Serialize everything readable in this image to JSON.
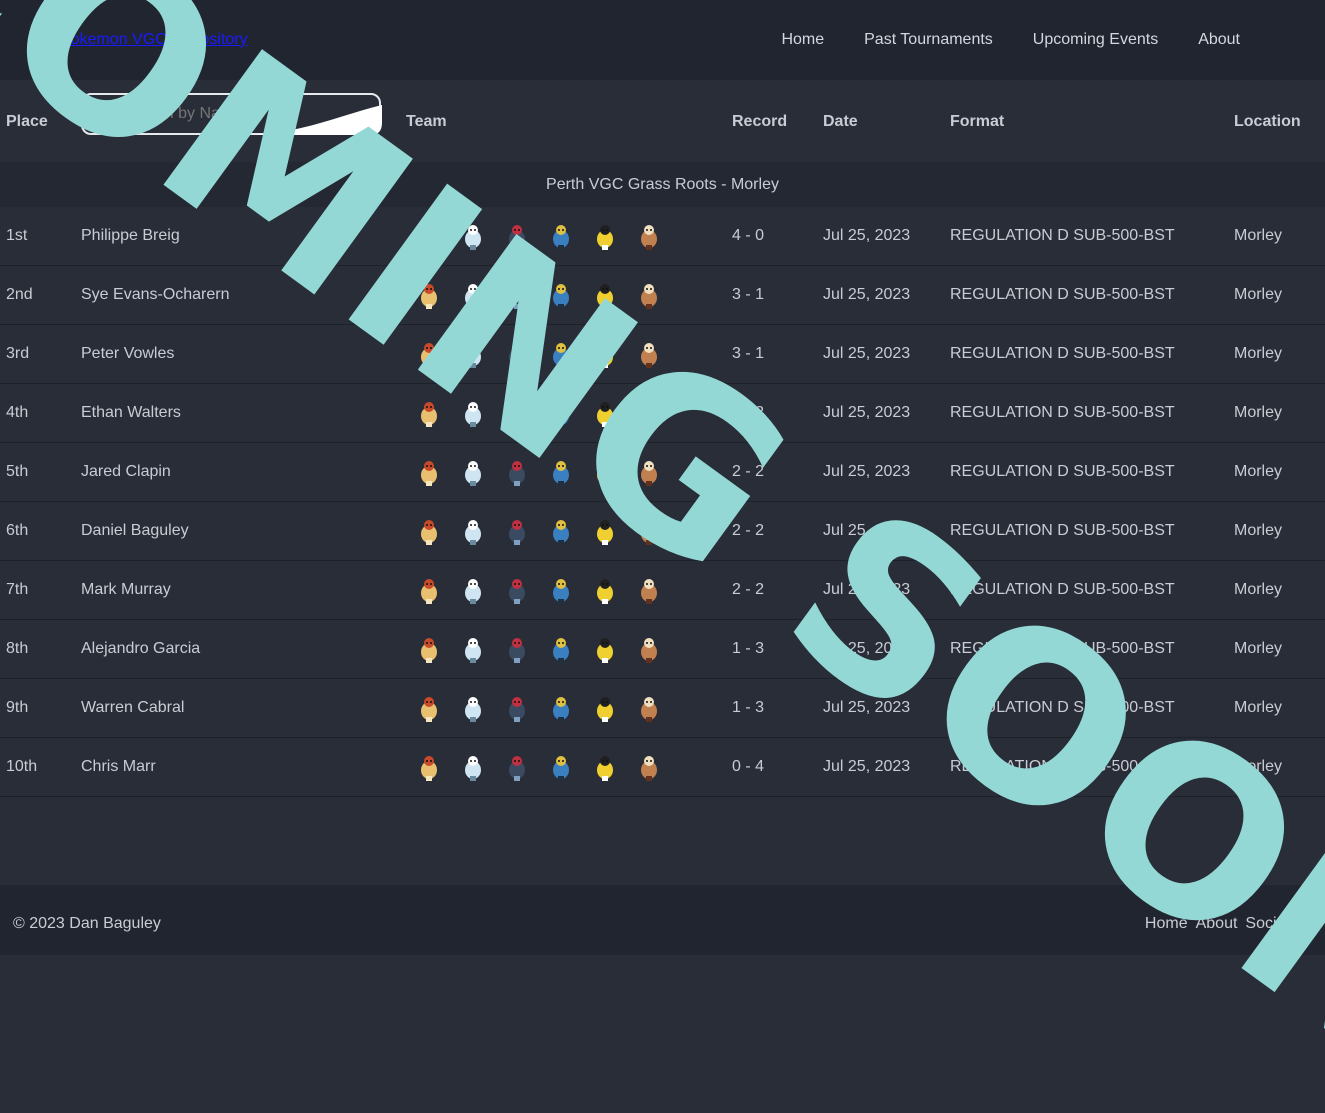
{
  "navbar": {
    "brand": "Pokemon VGC Repository",
    "links": [
      "Home",
      "Past Tournaments",
      "Upcoming Events",
      "About"
    ]
  },
  "table": {
    "headers": {
      "place": "Place",
      "team": "Team",
      "record": "Record",
      "date": "Date",
      "format": "Format",
      "location": "Location"
    },
    "search_placeholder": "Search by Name",
    "event_name": "Perth VGC Grass Roots - Morley",
    "rows": [
      {
        "place": "1st",
        "name": "Philippe Breig",
        "record": "4 - 0",
        "date": "Jul 25, 2023",
        "format": "REGULATION D SUB-500-BST",
        "location": "Morley"
      },
      {
        "place": "2nd",
        "name": "Sye Evans-Ocharern",
        "record": "3 - 1",
        "date": "Jul 25, 2023",
        "format": "REGULATION D SUB-500-BST",
        "location": "Morley"
      },
      {
        "place": "3rd",
        "name": "Peter Vowles",
        "record": "3 - 1",
        "date": "Jul 25, 2023",
        "format": "REGULATION D SUB-500-BST",
        "location": "Morley"
      },
      {
        "place": "4th",
        "name": "Ethan Walters",
        "record": "2 - 2",
        "date": "Jul 25, 2023",
        "format": "REGULATION D SUB-500-BST",
        "location": "Morley"
      },
      {
        "place": "5th",
        "name": "Jared Clapin",
        "record": "2 - 2",
        "date": "Jul 25, 2023",
        "format": "REGULATION D SUB-500-BST",
        "location": "Morley"
      },
      {
        "place": "6th",
        "name": "Daniel Baguley",
        "record": "2 - 2",
        "date": "Jul 25, 2023",
        "format": "REGULATION D SUB-500-BST",
        "location": "Morley"
      },
      {
        "place": "7th",
        "name": "Mark Murray",
        "record": "2 - 2",
        "date": "Jul 25, 2023",
        "format": "REGULATION D SUB-500-BST",
        "location": "Morley"
      },
      {
        "place": "8th",
        "name": "Alejandro Garcia",
        "record": "1 - 3",
        "date": "Jul 25, 2023",
        "format": "REGULATION D SUB-500-BST",
        "location": "Morley"
      },
      {
        "place": "9th",
        "name": "Warren Cabral",
        "record": "1 - 3",
        "date": "Jul 25, 2023",
        "format": "REGULATION D SUB-500-BST",
        "location": "Morley"
      },
      {
        "place": "10th",
        "name": "Chris Marr",
        "record": "0 - 4",
        "date": "Jul 25, 2023",
        "format": "REGULATION D SUB-500-BST",
        "location": "Morley"
      }
    ]
  },
  "footer": {
    "copyright": "© 2023 Dan Baguley",
    "links": [
      "Home",
      "About",
      "Socials"
    ]
  },
  "overlay": {
    "text": "COMING SOON",
    "color": "#94d8d6"
  },
  "icons": {
    "team_sprite": "pokemon-sprite-icon"
  }
}
